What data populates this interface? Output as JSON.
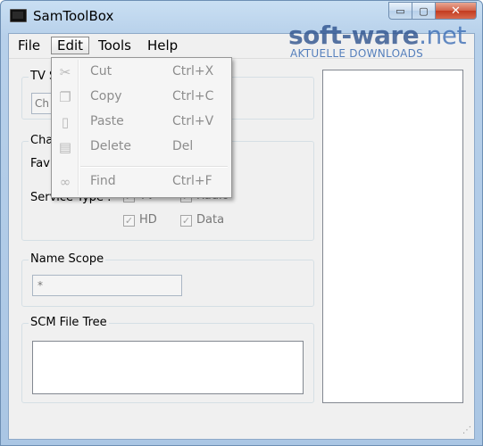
{
  "window": {
    "title": "SamToolBox",
    "minimize": "▭",
    "maximize": "▢",
    "close": "✕"
  },
  "menu": [
    "File",
    "Edit",
    "Tools",
    "Help"
  ],
  "edit_menu": [
    {
      "label": "Cut",
      "shortcut": "Ctrl+X",
      "icon": "scissors-icon"
    },
    {
      "label": "Copy",
      "shortcut": "Ctrl+C",
      "icon": "copy-icon"
    },
    {
      "label": "Paste",
      "shortcut": "Ctrl+V",
      "icon": "paste-icon"
    },
    {
      "label": "Delete",
      "shortcut": "Del",
      "icon": "trash-icon"
    },
    {
      "label": "Find",
      "shortcut": "Ctrl+F",
      "icon": "binoculars-icon"
    }
  ],
  "groups": {
    "tv_partial": "TV S",
    "tv_input_partial": "Ch",
    "channel_partial": "Cha",
    "favorite_partial": "Fav",
    "service_type_label": "Service Type :",
    "tv": "TV",
    "radio": "Radio",
    "hd": "HD",
    "data": "Data",
    "name_scope": "Name Scope",
    "name_scope_value": "*",
    "scm_file_tree": "SCM File Tree"
  },
  "watermark": {
    "main": "soft-ware",
    "suffix": ".net",
    "sub": "AKTUELLE DOWNLOADS"
  },
  "check_mark": "✓"
}
